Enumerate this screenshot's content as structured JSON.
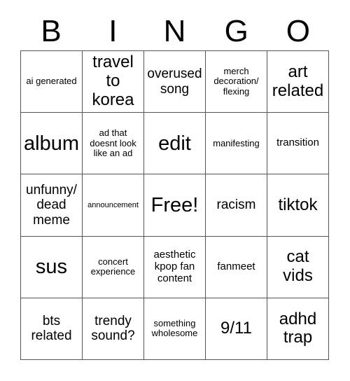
{
  "card": {
    "header_letters": [
      "B",
      "I",
      "N",
      "G",
      "O"
    ],
    "free_space_label": "Free!",
    "rows": [
      [
        {
          "text": "ai generated",
          "size": "fs-s"
        },
        {
          "text": "travel to korea",
          "size": "fs-xl"
        },
        {
          "text": "overused song",
          "size": "fs-l"
        },
        {
          "text": "merch decoration/ flexing",
          "size": "fs-s"
        },
        {
          "text": "art related",
          "size": "fs-xl"
        }
      ],
      [
        {
          "text": "album",
          "size": "fs-xxl"
        },
        {
          "text": "ad that doesnt look like an ad",
          "size": "fs-s"
        },
        {
          "text": "edit",
          "size": "fs-xxl"
        },
        {
          "text": "manifesting",
          "size": "fs-s"
        },
        {
          "text": "transition",
          "size": "fs-m"
        }
      ],
      [
        {
          "text": "unfunny/ dead meme",
          "size": "fs-l"
        },
        {
          "text": "announcement",
          "size": "fs-xs"
        },
        {
          "text": "Free!",
          "size": "fs-free"
        },
        {
          "text": "racism",
          "size": "fs-l"
        },
        {
          "text": "tiktok",
          "size": "fs-xl"
        }
      ],
      [
        {
          "text": "sus",
          "size": "fs-xxl"
        },
        {
          "text": "concert experience",
          "size": "fs-s"
        },
        {
          "text": "aesthetic kpop fan content",
          "size": "fs-m"
        },
        {
          "text": "fanmeet",
          "size": "fs-m"
        },
        {
          "text": "cat vids",
          "size": "fs-xl"
        }
      ],
      [
        {
          "text": "bts related",
          "size": "fs-l"
        },
        {
          "text": "trendy sound?",
          "size": "fs-l"
        },
        {
          "text": "something wholesome",
          "size": "fs-s"
        },
        {
          "text": "9/11",
          "size": "fs-xl"
        },
        {
          "text": "adhd trap",
          "size": "fs-xl"
        }
      ]
    ]
  }
}
